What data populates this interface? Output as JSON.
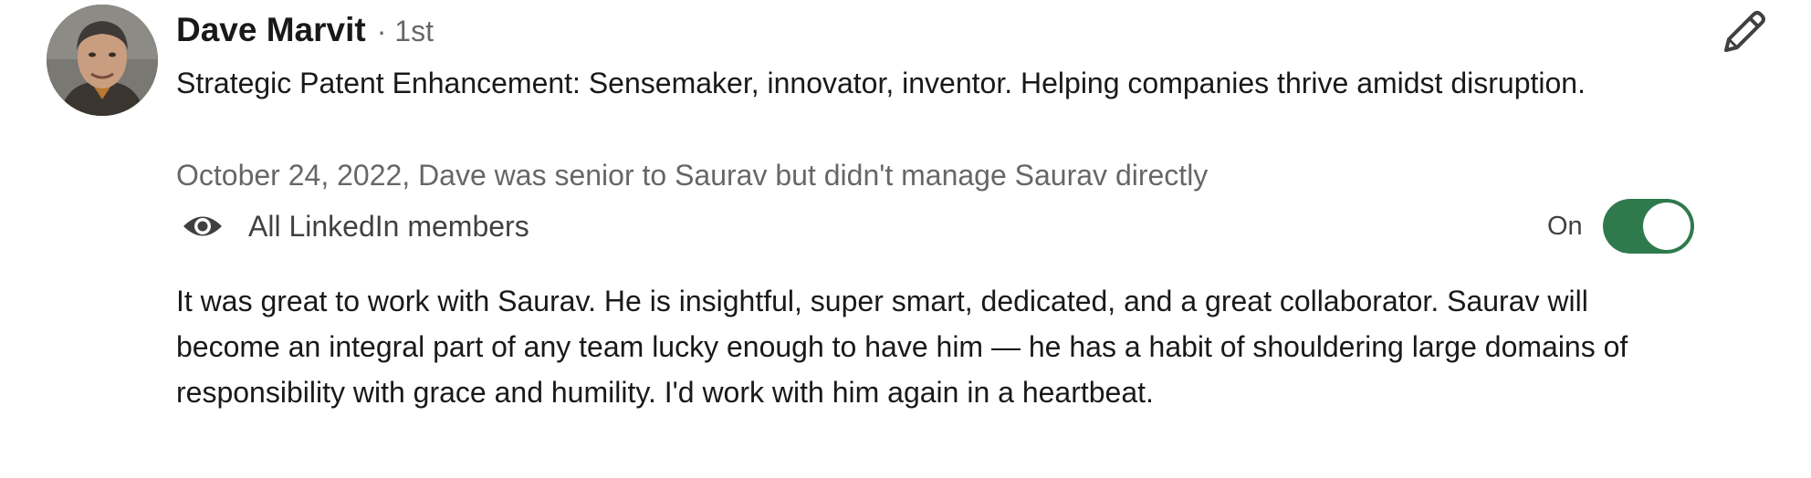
{
  "recommender": {
    "name": "Dave Marvit",
    "connection_degree": "· 1st",
    "headline": "Strategic Patent Enhancement: Sensemaker, innovator, inventor. Helping companies thrive amidst disruption.",
    "relationship": "October 24, 2022, Dave was senior to Saurav but didn't manage Saurav directly"
  },
  "visibility": {
    "icon": "eye-icon",
    "label": "All LinkedIn members",
    "toggle_state": "On",
    "toggle_on": true,
    "toggle_color": "#2f7a4d"
  },
  "recommendation": {
    "text": "It was great to work with Saurav. He is insightful, super smart, dedicated, and a great collaborator. Saurav will become an integral part of any team lucky enough to have him — he has a habit of shouldering large domains of responsibility with grace and humility. I'd work with him again in a heartbeat."
  },
  "actions": {
    "edit_icon": "pencil-icon"
  }
}
